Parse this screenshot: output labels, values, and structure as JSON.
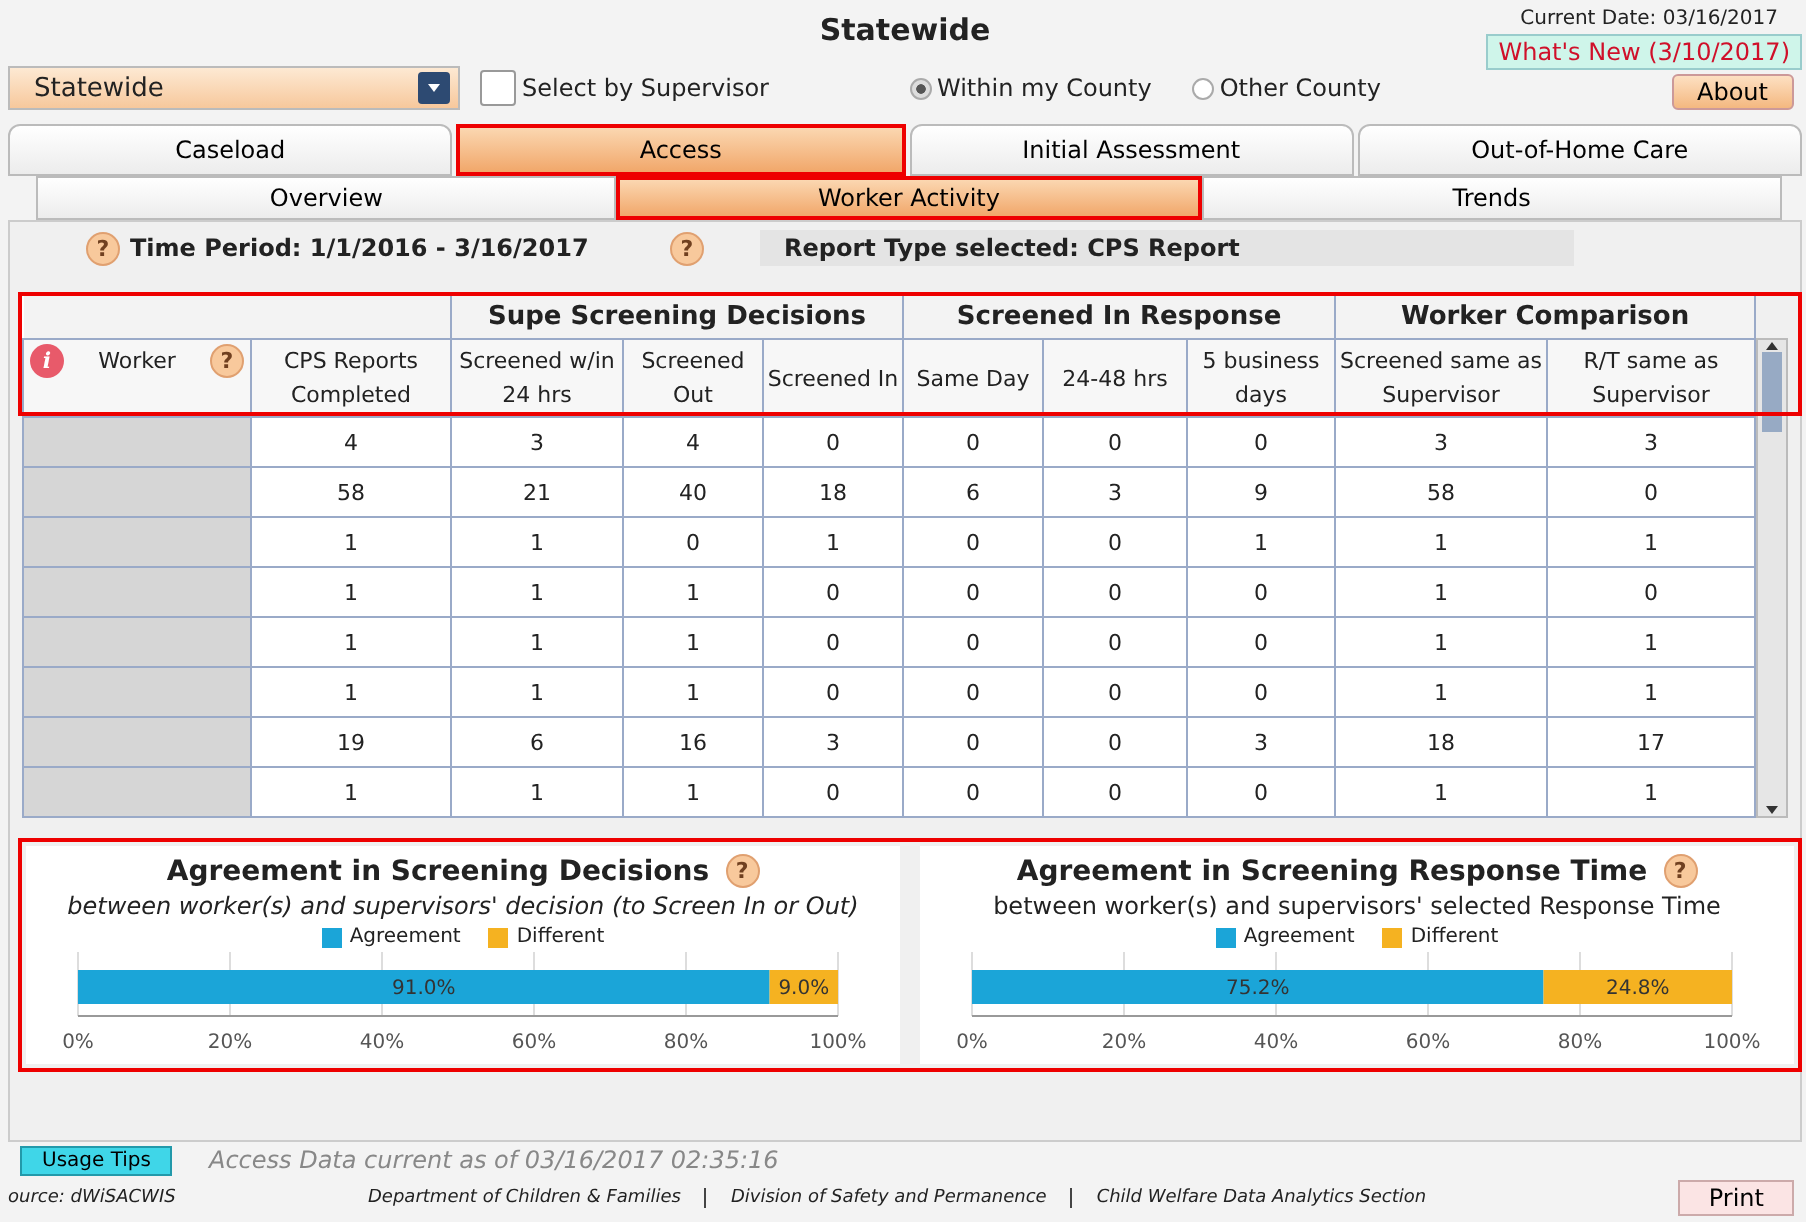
{
  "header": {
    "title": "Statewide",
    "current_date": "Current Date: 03/16/2017",
    "whats_new": "What's New (3/10/2017)",
    "about": "About"
  },
  "scope_select": {
    "value": "Statewide"
  },
  "supervisor_checkbox": {
    "label": "Select by Supervisor",
    "checked": false
  },
  "county_radios": [
    {
      "label": "Within my County",
      "selected": true
    },
    {
      "label": "Other County",
      "selected": false
    }
  ],
  "tabs": [
    {
      "label": "Caseload",
      "selected": false,
      "highlighted": false
    },
    {
      "label": "Access",
      "selected": true,
      "highlighted": true
    },
    {
      "label": "Initial Assessment",
      "selected": false,
      "highlighted": false
    },
    {
      "label": "Out-of-Home Care",
      "selected": false,
      "highlighted": false
    }
  ],
  "subtabs": [
    {
      "label": "Overview",
      "selected": false,
      "highlighted": false
    },
    {
      "label": "Worker Activity",
      "selected": true,
      "highlighted": true
    },
    {
      "label": "Trends",
      "selected": false,
      "highlighted": false
    }
  ],
  "filter_bar": {
    "time_period": "Time Period: 1/1/2016 - 3/16/2017",
    "report_type": "Report Type selected: CPS Report",
    "help": [
      "?",
      "?"
    ]
  },
  "table": {
    "header_highlighted": true,
    "info_icon": "i",
    "help": "?",
    "groups": [
      "Supe Screening Decisions",
      "Screened In Response",
      "Worker Comparison"
    ],
    "columns": [
      "Worker",
      "CPS Reports Completed",
      "Screened w/in 24 hrs",
      "Screened Out",
      "Screened In",
      "Same Day",
      "24-48 hrs",
      "5 business days",
      "Screened same as Supervisor",
      "R/T same as Supervisor"
    ],
    "rows": [
      [
        "",
        "4",
        "3",
        "4",
        "0",
        "0",
        "0",
        "0",
        "3",
        "3"
      ],
      [
        "",
        "58",
        "21",
        "40",
        "18",
        "6",
        "3",
        "9",
        "58",
        "0"
      ],
      [
        "",
        "1",
        "1",
        "0",
        "1",
        "0",
        "0",
        "1",
        "1",
        "1"
      ],
      [
        "",
        "1",
        "1",
        "1",
        "0",
        "0",
        "0",
        "0",
        "1",
        "0"
      ],
      [
        "",
        "1",
        "1",
        "1",
        "0",
        "0",
        "0",
        "0",
        "1",
        "1"
      ],
      [
        "",
        "1",
        "1",
        "1",
        "0",
        "0",
        "0",
        "0",
        "1",
        "1"
      ],
      [
        "",
        "19",
        "6",
        "16",
        "3",
        "0",
        "0",
        "3",
        "18",
        "17"
      ],
      [
        "",
        "1",
        "1",
        "1",
        "0",
        "0",
        "0",
        "0",
        "1",
        "1"
      ]
    ]
  },
  "charts_highlighted": true,
  "charts": [
    {
      "title": "Agreement in Screening Decisions",
      "subtitle": "between worker(s) and supervisors' decision (to Screen In or Out)",
      "subtitle_italic": true,
      "help": "?",
      "chart_data": {
        "type": "bar",
        "orientation": "horizontal",
        "stacked": true,
        "grid": true,
        "series": [
          {
            "name": "Agreement",
            "color": "#1ba5d8",
            "values": [
              91.0
            ]
          },
          {
            "name": "Different",
            "color": "#f5b221",
            "values": [
              9.0
            ]
          }
        ],
        "xlim": [
          0,
          100
        ],
        "xticks": [
          {
            "value": 0,
            "label": "0%"
          },
          {
            "value": 20,
            "label": "20%"
          },
          {
            "value": 40,
            "label": "40%"
          },
          {
            "value": 60,
            "label": "60%"
          },
          {
            "value": 80,
            "label": "80%"
          },
          {
            "value": 100,
            "label": "100%"
          }
        ],
        "value_labels": [
          [
            "91.0%"
          ],
          [
            "9.0%"
          ]
        ]
      }
    },
    {
      "title": "Agreement in Screening Response Time",
      "subtitle": "between worker(s) and supervisors' selected Response Time",
      "subtitle_italic": false,
      "help": "?",
      "chart_data": {
        "type": "bar",
        "orientation": "horizontal",
        "stacked": true,
        "grid": true,
        "series": [
          {
            "name": "Agreement",
            "color": "#1ba5d8",
            "values": [
              75.2
            ]
          },
          {
            "name": "Different",
            "color": "#f5b221",
            "values": [
              24.8
            ]
          }
        ],
        "xlim": [
          0,
          100
        ],
        "xticks": [
          {
            "value": 0,
            "label": "0%"
          },
          {
            "value": 20,
            "label": "20%"
          },
          {
            "value": 40,
            "label": "40%"
          },
          {
            "value": 60,
            "label": "60%"
          },
          {
            "value": 80,
            "label": "80%"
          },
          {
            "value": 100,
            "label": "100%"
          }
        ],
        "value_labels": [
          [
            "75.2%"
          ],
          [
            "24.8%"
          ]
        ]
      }
    }
  ],
  "footer": {
    "usage_tips": "Usage Tips",
    "data_current": "Access Data current as of 03/16/2017 02:35:16",
    "source": "ource:  dWiSACWIS",
    "links": [
      "Department of Children & Families",
      "Division of Safety and Permanence",
      "Child Welfare Data Analytics Section"
    ],
    "print": "Print"
  }
}
